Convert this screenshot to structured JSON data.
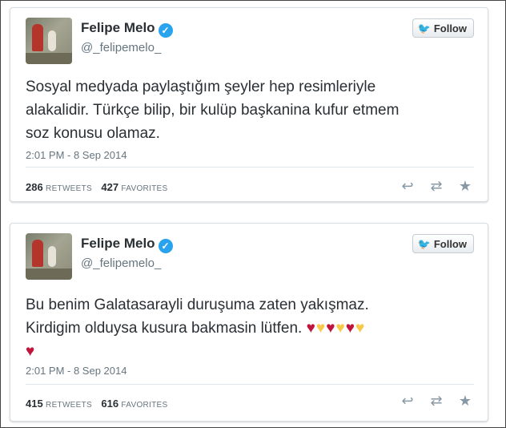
{
  "tweets": [
    {
      "user": {
        "name": "Felipe Melo",
        "handle": "@_felipemelo_"
      },
      "follow_label": "Follow",
      "text_lines": [
        "Sosyal medyada paylaştığım şeyler hep resimleriyle",
        "alakalidir. Türkçe bilip, bir kulüp başkanina kufur etmem",
        "soz konusu olamaz."
      ],
      "timestamp": "2:01 PM - 8 Sep 2014",
      "retweets": {
        "count": "286",
        "label": "RETWEETS"
      },
      "favorites": {
        "count": "427",
        "label": "FAVORITES"
      }
    },
    {
      "user": {
        "name": "Felipe Melo",
        "handle": "@_felipemelo_"
      },
      "follow_label": "Follow",
      "text_lines": [
        "Bu benim Galatasarayli duruşuma zaten yakışmaz.",
        "Kirdigim olduysa kusura bakmasin lütfen."
      ],
      "hearts_line_1": [
        "red-heart",
        "yellow-heart",
        "red-heart",
        "yellow-heart",
        "red-heart",
        "yellow-heart"
      ],
      "hearts_line_2": [
        "red-heart"
      ],
      "timestamp": "2:01 PM - 8 Sep 2014",
      "retweets": {
        "count": "415",
        "label": "RETWEETS"
      },
      "favorites": {
        "count": "616",
        "label": "FAVORITES"
      }
    }
  ],
  "icons": {
    "verified": "verified-badge-icon",
    "follow": "twitter-bird-icon",
    "reply": "reply-icon",
    "retweet": "retweet-icon",
    "favorite": "star-icon"
  },
  "colors": {
    "accent": "#2aa3ef",
    "text": "#292f33",
    "muted": "#66757f",
    "heart_red": "#c0143c",
    "heart_yellow": "#f7c948"
  }
}
